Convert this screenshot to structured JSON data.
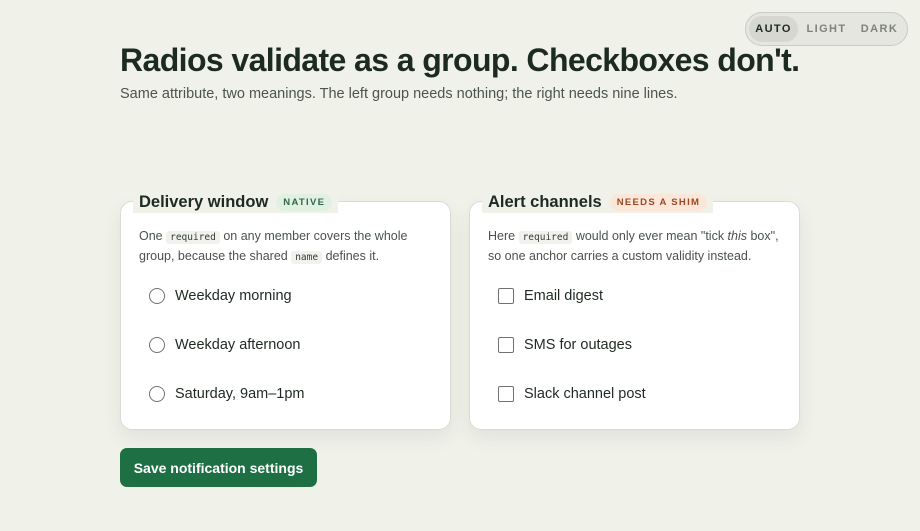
{
  "theme_switcher": {
    "options": [
      "AUTO",
      "LIGHT",
      "DARK"
    ],
    "selected": "AUTO"
  },
  "header": {
    "title": "Radios validate as a group. Checkboxes don't.",
    "subtitle": "Same attribute, two meanings. The left group needs nothing; the right needs nine lines."
  },
  "left_card": {
    "title": "Delivery window",
    "badge": "NATIVE",
    "desc_part1": "One ",
    "desc_code1": "required",
    "desc_part2": " on any member covers the whole group, because the shared ",
    "desc_code2": "name",
    "desc_part3": " defines it.",
    "options": [
      "Weekday morning",
      "Weekday afternoon",
      "Saturday, 9am–1pm"
    ]
  },
  "right_card": {
    "title": "Alert channels",
    "badge": "NEEDS A SHIM",
    "desc_part1": "Here ",
    "desc_code1": "required",
    "desc_part2": " would only ever mean \"tick ",
    "desc_em": "this",
    "desc_part3": " box\", so one anchor carries a custom validity instead.",
    "options": [
      "Email digest",
      "SMS for outages",
      "Slack channel post"
    ]
  },
  "actions": {
    "save_label": "Save notification settings"
  },
  "colors": {
    "background": "#f0f2ea",
    "primary_button": "#1f6f45",
    "native_badge": "#e2f0e4",
    "shim_badge": "#fbe7da"
  }
}
